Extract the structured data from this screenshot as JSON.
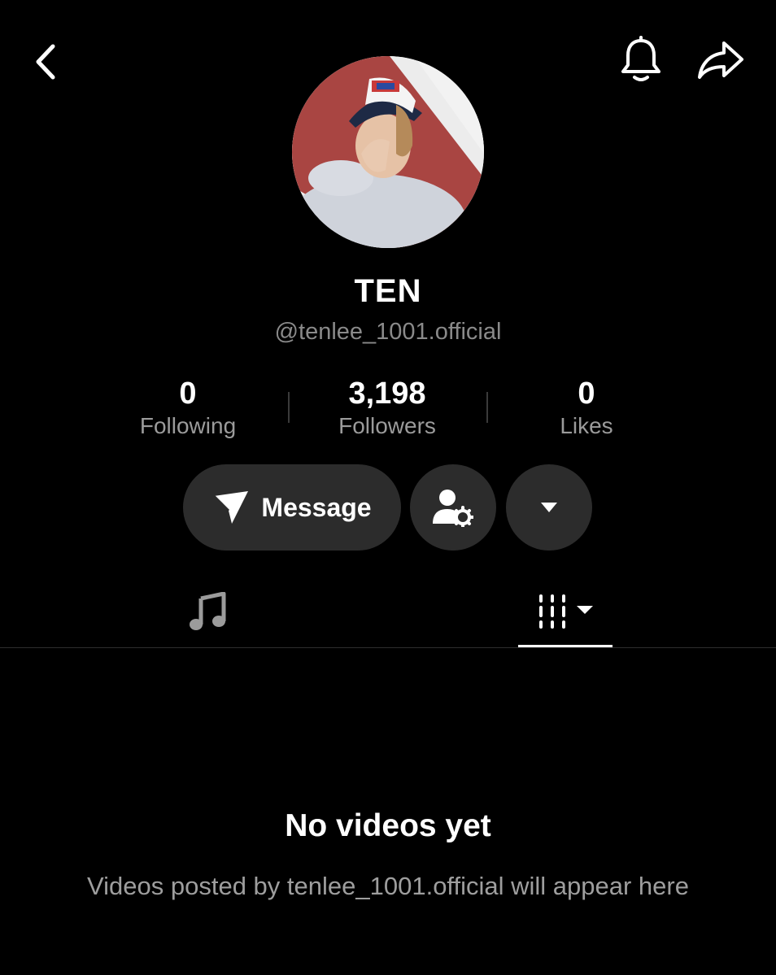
{
  "header": {
    "back_icon": "chevron-left-icon",
    "notification_icon": "bell-icon",
    "share_icon": "share-arrow-icon"
  },
  "profile": {
    "avatar_description": "profile photo",
    "display_name": "TEN",
    "username": "@tenlee_1001.official"
  },
  "stats": [
    {
      "value": "0",
      "label": "Following"
    },
    {
      "value": "3,198",
      "label": "Followers"
    },
    {
      "value": "0",
      "label": "Likes"
    }
  ],
  "actions": {
    "message_label": "Message",
    "message_icon": "send-icon",
    "manage_icon": "user-settings-icon",
    "more_icon": "caret-down-icon"
  },
  "tabs": [
    {
      "icon": "music-note-icon",
      "active": false
    },
    {
      "icon": "video-grid-icon",
      "active": true
    }
  ],
  "empty_state": {
    "title": "No videos yet",
    "subtitle": "Videos posted by tenlee_1001.official will appear here"
  },
  "colors": {
    "background": "#000000",
    "button_bg": "#2c2c2c",
    "muted_text": "#9b9b9b",
    "primary_text": "#ffffff"
  }
}
